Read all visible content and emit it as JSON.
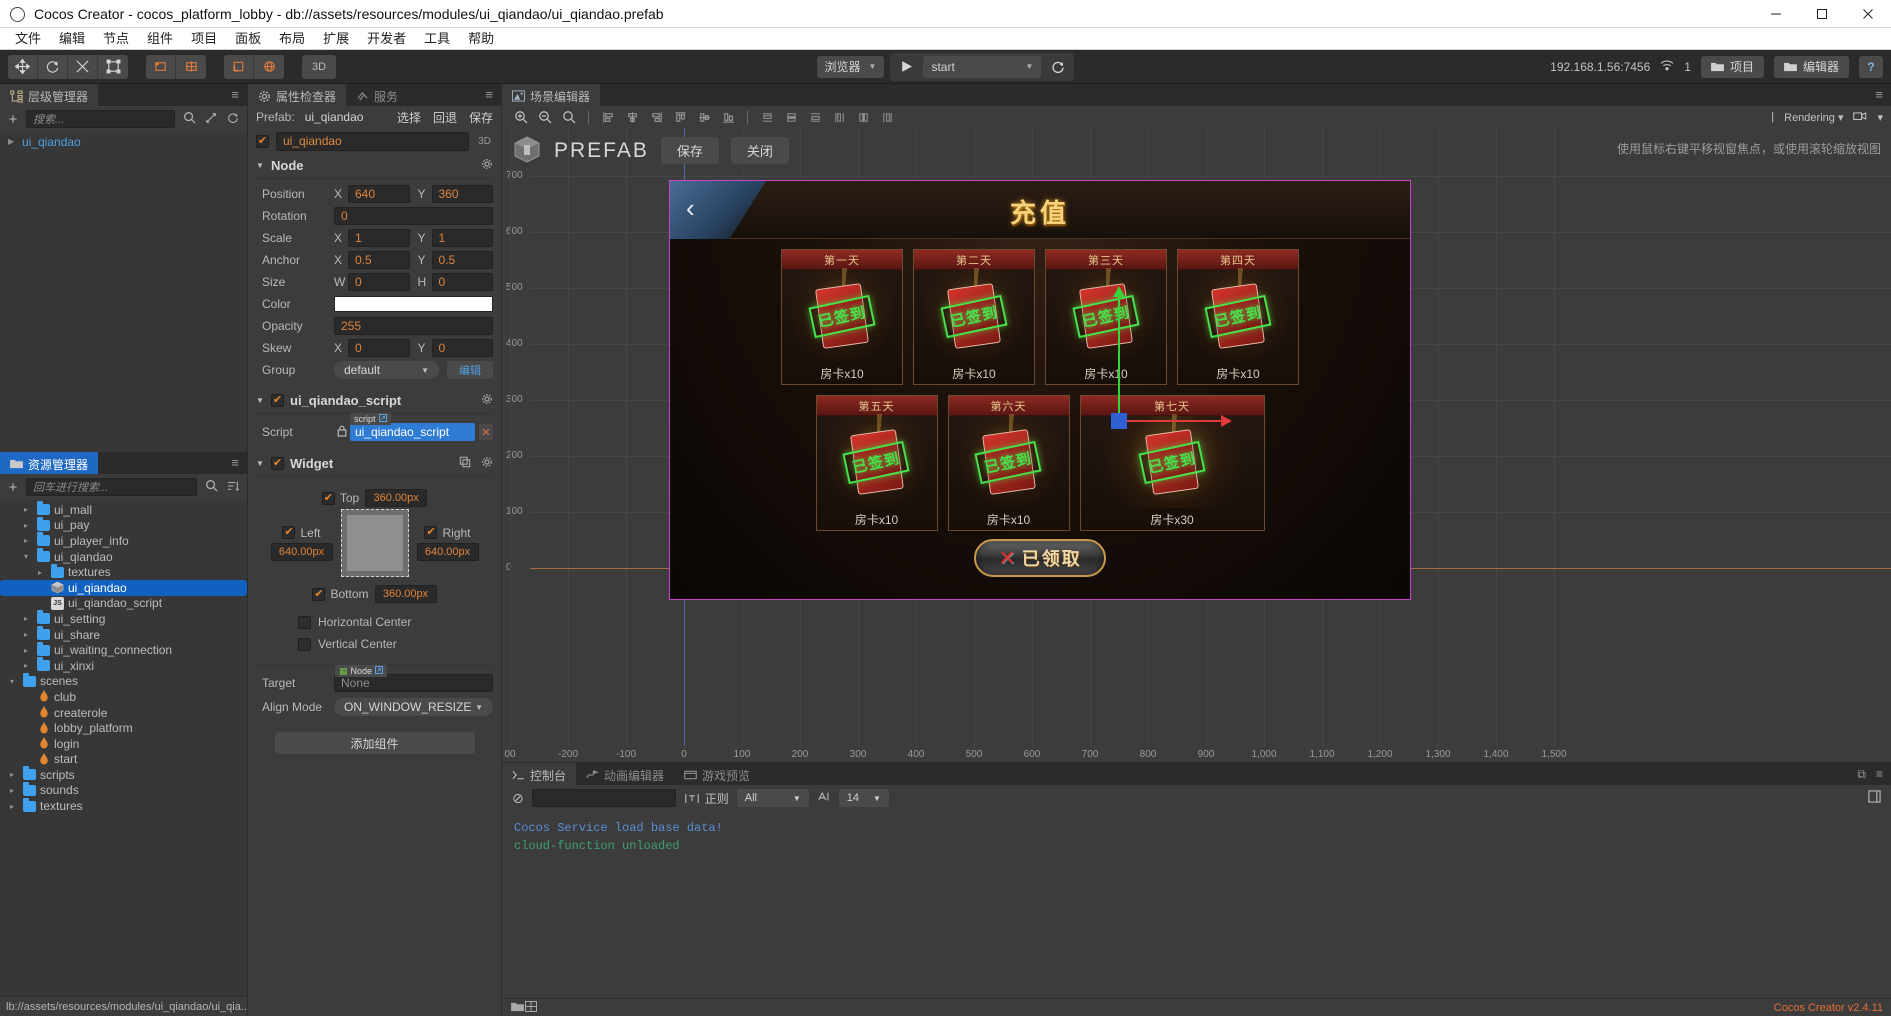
{
  "window": {
    "title": "Cocos Creator - cocos_platform_lobby - db://assets/resources/modules/ui_qiandao/ui_qiandao.prefab",
    "minimize": "–",
    "maximize": "▢",
    "close": "✕"
  },
  "menubar": {
    "items": [
      "文件",
      "编辑",
      "节点",
      "组件",
      "项目",
      "面板",
      "布局",
      "扩展",
      "开发者",
      "工具",
      "帮助"
    ]
  },
  "toolbar": {
    "transform_tools": [
      "move-tool",
      "rotate-tool",
      "scale-tool",
      "rect-tool"
    ],
    "pivot_tools": [
      "pivot-tool",
      "anchor-tool"
    ],
    "coord_tools": [
      "local-coord-tool",
      "global-coord-tool"
    ],
    "dimension_label": "3D",
    "preview_target": "浏览器",
    "play_scene": "start",
    "refresh_label": "↻",
    "address": "192.168.1.56:7456",
    "device_count": "1",
    "project_button": "项目",
    "editor_button": "编辑器",
    "help_button": "?"
  },
  "hierarchy": {
    "tab": "层级管理器",
    "search_placeholder": "搜索...",
    "nodes": [
      {
        "label": "ui_qiandao",
        "expanded": false
      }
    ]
  },
  "assets": {
    "tab": "资源管理器",
    "search_placeholder": "回车进行搜索...",
    "tree": [
      {
        "label": "ui_mall",
        "type": "folder",
        "depth": 1,
        "arrow": "▸",
        "selected": false
      },
      {
        "label": "ui_pay",
        "type": "folder",
        "depth": 1,
        "arrow": "▸",
        "selected": false
      },
      {
        "label": "ui_player_info",
        "type": "folder",
        "depth": 1,
        "arrow": "▸",
        "selected": false
      },
      {
        "label": "ui_qiandao",
        "type": "folder",
        "depth": 1,
        "arrow": "▾",
        "selected": false
      },
      {
        "label": "textures",
        "type": "folder",
        "depth": 2,
        "arrow": "▸",
        "selected": false
      },
      {
        "label": "ui_qiandao",
        "type": "prefab",
        "depth": 2,
        "arrow": "",
        "selected": true
      },
      {
        "label": "ui_qiandao_script",
        "type": "script",
        "depth": 2,
        "arrow": "",
        "selected": false
      },
      {
        "label": "ui_setting",
        "type": "folder",
        "depth": 1,
        "arrow": "▸",
        "selected": false
      },
      {
        "label": "ui_share",
        "type": "folder",
        "depth": 1,
        "arrow": "▸",
        "selected": false
      },
      {
        "label": "ui_waiting_connection",
        "type": "folder",
        "depth": 1,
        "arrow": "▸",
        "selected": false
      },
      {
        "label": "ui_xinxi",
        "type": "folder",
        "depth": 1,
        "arrow": "▸",
        "selected": false
      },
      {
        "label": "scenes",
        "type": "folder",
        "depth": 0,
        "arrow": "▾",
        "selected": false
      },
      {
        "label": "club",
        "type": "scene",
        "depth": 1,
        "arrow": "",
        "selected": false
      },
      {
        "label": "createrole",
        "type": "scene",
        "depth": 1,
        "arrow": "",
        "selected": false
      },
      {
        "label": "lobby_platform",
        "type": "scene",
        "depth": 1,
        "arrow": "",
        "selected": false
      },
      {
        "label": "login",
        "type": "scene",
        "depth": 1,
        "arrow": "",
        "selected": false
      },
      {
        "label": "start",
        "type": "scene",
        "depth": 1,
        "arrow": "",
        "selected": false
      },
      {
        "label": "scripts",
        "type": "folder",
        "depth": 0,
        "arrow": "▸",
        "selected": false
      },
      {
        "label": "sounds",
        "type": "folder",
        "depth": 0,
        "arrow": "▸",
        "selected": false
      },
      {
        "label": "textures",
        "type": "folder",
        "depth": 0,
        "arrow": "▸",
        "selected": false
      }
    ],
    "status_path": "lb://assets/resources/modules/ui_qiandao/ui_qia..."
  },
  "inspector": {
    "tabs": [
      {
        "label": "属性检查器",
        "active": true
      },
      {
        "label": "服务",
        "active": false
      }
    ],
    "prefab_label": "Prefab:",
    "prefab_name": "ui_qiandao",
    "prefab_actions": [
      "选择",
      "回退",
      "保存"
    ],
    "node_name": "ui_qiandao",
    "dimension_tag": "3D",
    "node_section": "Node",
    "properties": {
      "position": {
        "label": "Position",
        "x_label": "X",
        "x": "640",
        "y_label": "Y",
        "y": "360"
      },
      "rotation": {
        "label": "Rotation",
        "value": "0"
      },
      "scale": {
        "label": "Scale",
        "x_label": "X",
        "x": "1",
        "y_label": "Y",
        "y": "1"
      },
      "anchor": {
        "label": "Anchor",
        "x_label": "X",
        "x": "0.5",
        "y_label": "Y",
        "y": "0.5"
      },
      "size": {
        "label": "Size",
        "w_label": "W",
        "w": "0",
        "h_label": "H",
        "h": "0"
      },
      "color": {
        "label": "Color",
        "value": "#FFFFFF"
      },
      "opacity": {
        "label": "Opacity",
        "value": "255"
      },
      "skew": {
        "label": "Skew",
        "x_label": "X",
        "x": "0",
        "y_label": "Y",
        "y": "0"
      },
      "group": {
        "label": "Group",
        "value": "default",
        "edit_button": "编辑"
      }
    },
    "script_component": {
      "title": "ui_qiandao_script",
      "script_label": "Script",
      "script_tag": "script",
      "script_value": "ui_qiandao_script"
    },
    "widget": {
      "title": "Widget",
      "top": {
        "label": "Top",
        "value": "360.00px",
        "checked": true
      },
      "left": {
        "label": "Left",
        "value": "640.00px",
        "checked": true
      },
      "right": {
        "label": "Right",
        "value": "640.00px",
        "checked": true
      },
      "bottom": {
        "label": "Bottom",
        "value": "360.00px",
        "checked": true
      },
      "horizontal_center": {
        "label": "Horizontal Center",
        "checked": false
      },
      "vertical_center": {
        "label": "Vertical Center",
        "checked": false
      },
      "target": {
        "label": "Target",
        "tag": "Node",
        "value": "None"
      },
      "align_mode": {
        "label": "Align Mode",
        "value": "ON_WINDOW_RESIZE"
      }
    },
    "add_component": "添加组件"
  },
  "scene": {
    "tab": "场景编辑器",
    "rendering_label": "Rendering",
    "hint": "使用鼠标右键平移视窗焦点，或使用滚轮缩放视图",
    "prefab_banner": "PREFAB",
    "prefab_save": "保存",
    "prefab_close": "关闭",
    "ruler_y": [
      "700",
      "600",
      "500",
      "400",
      "300",
      "200",
      "100",
      "0"
    ],
    "ruler_x": [
      "00",
      "-200",
      "-100",
      "0",
      "100",
      "200",
      "300",
      "400",
      "500",
      "600",
      "700",
      "800",
      "900",
      "1,000",
      "1,100",
      "1,200",
      "1,300",
      "1,400",
      "1,500"
    ]
  },
  "game": {
    "title": "充值",
    "back_icon": "‹",
    "cards": [
      {
        "header": "第一天",
        "stamp": "已签到",
        "label": "房卡x10",
        "big": false
      },
      {
        "header": "第二天",
        "stamp": "已签到",
        "label": "房卡x10",
        "big": false
      },
      {
        "header": "第三天",
        "stamp": "已签到",
        "label": "房卡x10",
        "big": false
      },
      {
        "header": "第四天",
        "stamp": "已签到",
        "label": "房卡x10",
        "big": false
      },
      {
        "header": "第五天",
        "stamp": "已签到",
        "label": "房卡x10",
        "big": false
      },
      {
        "header": "第六天",
        "stamp": "已签到",
        "label": "房卡x10",
        "big": false
      },
      {
        "header": "第七天",
        "stamp": "已签到",
        "label": "房卡x30",
        "big": true
      }
    ],
    "claim_button": {
      "icon": "✕",
      "label": "已领取"
    }
  },
  "console": {
    "tabs": [
      {
        "label": "控制台",
        "active": true
      },
      {
        "label": "动画编辑器",
        "active": false
      },
      {
        "label": "游戏预览",
        "active": false
      }
    ],
    "clear_icon": "⊘",
    "filter_placeholder": "",
    "regex_label": "正则",
    "level_filter": "All",
    "font_size": "14",
    "logs": [
      {
        "text": "Cocos Service load base data!",
        "color": "blue"
      },
      {
        "text": "cloud-function unloaded",
        "color": "green"
      }
    ]
  },
  "footer": {
    "version": "Cocos Creator v2.4.11"
  }
}
